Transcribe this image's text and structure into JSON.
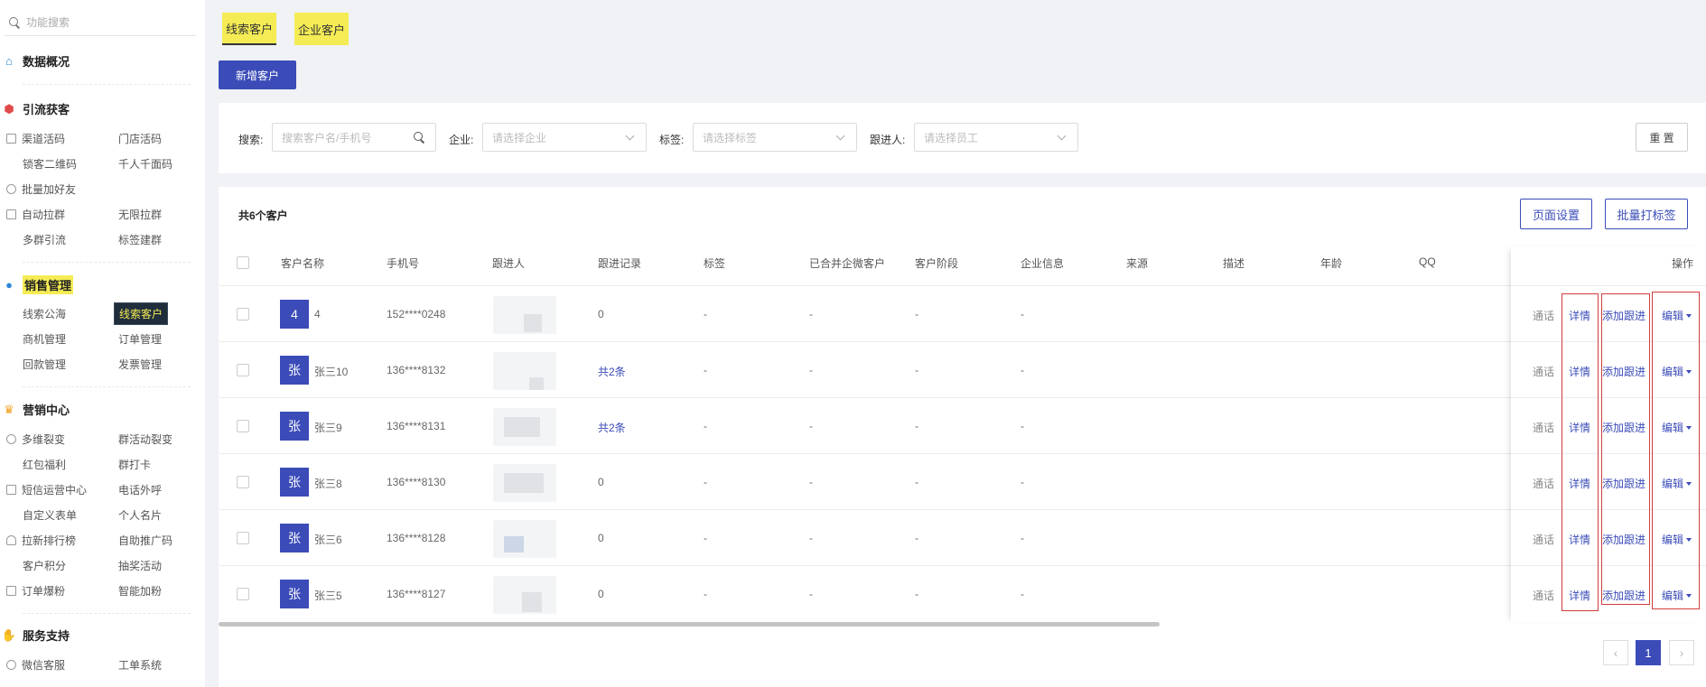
{
  "sidebar": {
    "search_placeholder": "功能搜索",
    "sections": {
      "overview": "数据概况",
      "acquire": "引流获客",
      "sales": "销售管理",
      "marketing": "营销中心",
      "service": "服务支持"
    },
    "items": {
      "channel_code": "渠道活码",
      "store_code": "门店活码",
      "lock_qr": "锁客二维码",
      "thousand_faces": "千人千面码",
      "batch_add": "批量加好友",
      "auto_group": "自动拉群",
      "unlimited_group": "无限拉群",
      "multi_group": "多群引流",
      "tag_group": "标签建群",
      "lead_pool": "线索公海",
      "lead_customers": "线索客户",
      "opportunity": "商机管理",
      "orders": "订单管理",
      "payment": "回款管理",
      "invoice": "发票管理",
      "multi_fission": "多维裂变",
      "group_fission": "群活动裂变",
      "red_packet": "红包福利",
      "group_checkin": "群打卡",
      "sms_center": "短信运营中心",
      "phone_call": "电话外呼",
      "custom_form": "自定义表单",
      "business_card": "个人名片",
      "ranking": "拉新排行榜",
      "promo_code": "自助推广码",
      "points": "客户积分",
      "lottery": "抽奖活动",
      "order_boost": "订单爆粉",
      "smart_add": "智能加粉",
      "wechat_service": "微信客服",
      "ticket_system": "工单系统"
    }
  },
  "tabs": [
    "线索客户",
    "企业客户"
  ],
  "add_button": "新增客户",
  "filters": {
    "search_label": "搜索:",
    "search_placeholder": "搜索客户名/手机号",
    "company_label": "企业:",
    "company_placeholder": "请选择企业",
    "tag_label": "标签:",
    "tag_placeholder": "请选择标签",
    "follower_label": "跟进人:",
    "follower_placeholder": "请选择员工",
    "reset": "重 置"
  },
  "table": {
    "count_text": "共6个客户",
    "page_settings": "页面设置",
    "batch_tag": "批量打标签",
    "columns": [
      "客户名称",
      "手机号",
      "跟进人",
      "跟进记录",
      "标签",
      "已合并企微客户",
      "客户阶段",
      "企业信息",
      "来源",
      "描述",
      "年龄",
      "QQ",
      "操作"
    ],
    "rows": [
      {
        "avatar": "4",
        "name": "4",
        "phone": "152****0248",
        "record": "0",
        "tag": "-",
        "merged": "-",
        "stage": "-",
        "company": "-"
      },
      {
        "avatar": "张",
        "name": "张三10",
        "phone": "136****8132",
        "record": "共2条",
        "tag": "-",
        "merged": "-",
        "stage": "-",
        "company": "-"
      },
      {
        "avatar": "张",
        "name": "张三9",
        "phone": "136****8131",
        "record": "共2条",
        "tag": "-",
        "merged": "-",
        "stage": "-",
        "company": "-"
      },
      {
        "avatar": "张",
        "name": "张三8",
        "phone": "136****8130",
        "record": "0",
        "tag": "-",
        "merged": "-",
        "stage": "-",
        "company": "-"
      },
      {
        "avatar": "张",
        "name": "张三6",
        "phone": "136****8128",
        "record": "0",
        "tag": "-",
        "merged": "-",
        "stage": "-",
        "company": "-"
      },
      {
        "avatar": "张",
        "name": "张三5",
        "phone": "136****8127",
        "record": "0",
        "tag": "-",
        "merged": "-",
        "stage": "-",
        "company": "-"
      }
    ],
    "actions": {
      "call": "通话",
      "detail": "详情",
      "add_follow": "添加跟进",
      "edit": "编辑"
    }
  },
  "pagination": {
    "current": "1",
    "prev": "‹",
    "next": "›"
  },
  "colors": {
    "primary": "#3b4cb8",
    "highlight": "#f5ec55",
    "annotation_red": "#d23c3c"
  }
}
